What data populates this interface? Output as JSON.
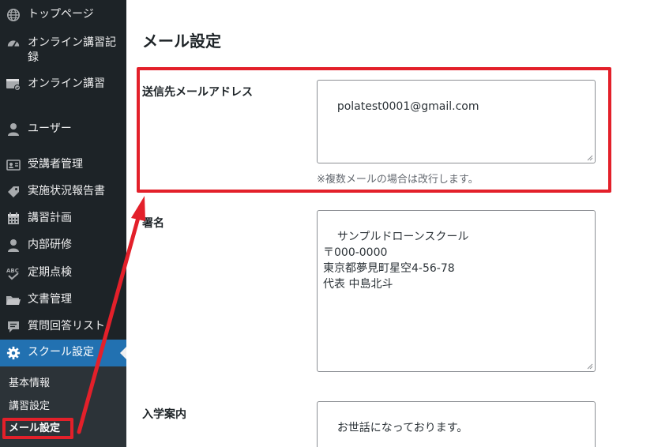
{
  "sidebar": {
    "items": [
      {
        "label": "トップページ",
        "icon": "globe-icon"
      },
      {
        "label": "オンライン講習記録",
        "icon": "dashboard-icon"
      },
      {
        "label": "オンライン講習",
        "icon": "video-check-icon"
      },
      {
        "label": "ユーザー",
        "icon": "user-icon"
      },
      {
        "label": "受講者管理",
        "icon": "id-card-icon"
      },
      {
        "label": "実施状況報告書",
        "icon": "tag-icon"
      },
      {
        "label": "講習計画",
        "icon": "calendar-icon"
      },
      {
        "label": "内部研修",
        "icon": "person-icon"
      },
      {
        "label": "定期点検",
        "icon": "spellcheck-icon"
      },
      {
        "label": "文書管理",
        "icon": "folder-icon"
      },
      {
        "label": "質問回答リスト",
        "icon": "comment-icon"
      },
      {
        "label": "スクール設定",
        "icon": "gear-icon"
      }
    ],
    "submenu": [
      {
        "label": "基本情報"
      },
      {
        "label": "講習設定"
      },
      {
        "label": "メール設定"
      }
    ]
  },
  "main": {
    "title": "メール設定",
    "fields": {
      "recipient": {
        "label": "送信先メールアドレス",
        "value": "polatest0001@gmail.com",
        "hint": "※複数メールの場合は改行します。"
      },
      "signature": {
        "label": "署名",
        "value": "サンプルドローンスクール\n〒000-0000\n東京都夢見町星空4-56-78\n代表 中島北斗"
      },
      "admission": {
        "label": "入学案内",
        "value": "お世話になっております。\n\nお申込み誠にありがとうございます。"
      }
    }
  },
  "colors": {
    "sidebar_bg": "#1d2327",
    "active_bg": "#2271b1",
    "annotation_red": "#e3202a"
  }
}
